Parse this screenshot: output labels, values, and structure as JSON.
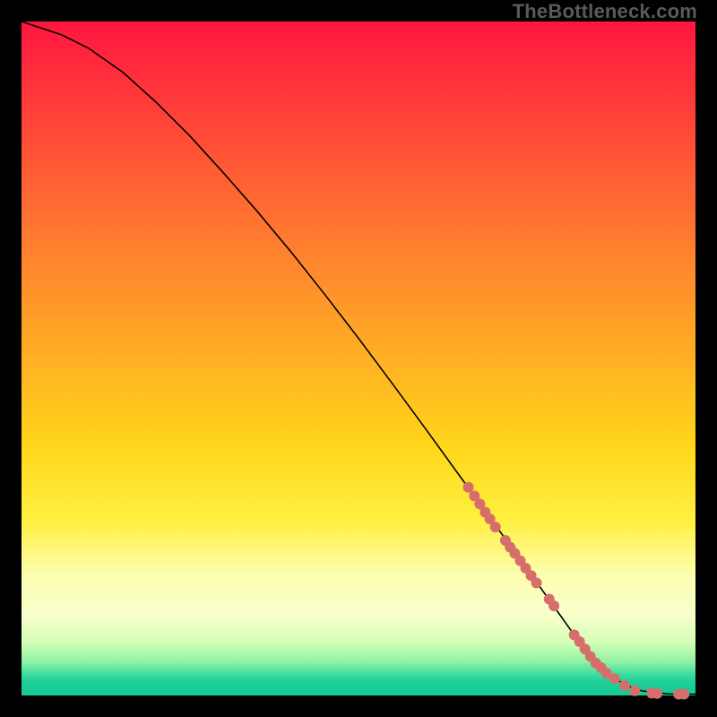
{
  "watermark": "TheBottleneck.com",
  "chart_data": {
    "type": "line",
    "title": "",
    "xlabel": "",
    "ylabel": "",
    "xlim": [
      0,
      100
    ],
    "ylim": [
      0,
      100
    ],
    "grid": false,
    "legend": false,
    "series": [
      {
        "name": "curve",
        "x": [
          0,
          3,
          6,
          10,
          15,
          20,
          25,
          30,
          35,
          40,
          45,
          50,
          55,
          60,
          65,
          70,
          75,
          80,
          82,
          84,
          86,
          88,
          90,
          92,
          94,
          96,
          98,
          100
        ],
        "y": [
          100,
          99,
          98,
          96,
          92.5,
          88,
          83,
          77.5,
          71.8,
          65.8,
          59.5,
          53,
          46.3,
          39.5,
          32.6,
          25.7,
          18.8,
          11.8,
          9,
          6.3,
          4.1,
          2.5,
          1.4,
          0.7,
          0.4,
          0.25,
          0.2,
          0.2
        ]
      }
    ],
    "points": {
      "name": "dots",
      "x": [
        66.3,
        67.2,
        68.0,
        68.8,
        69.5,
        70.3,
        71.8,
        72.5,
        73.2,
        74.0,
        74.8,
        75.6,
        76.4,
        78.3,
        79.0,
        82.0,
        82.8,
        83.6,
        84.4,
        85.2,
        86.0,
        86.8,
        88.0,
        89.5,
        91.0,
        93.5,
        94.3,
        97.5,
        98.3
      ],
      "y": [
        30.9,
        29.6,
        28.4,
        27.2,
        26.2,
        25.0,
        23.0,
        22.0,
        21.1,
        20.0,
        18.9,
        17.8,
        16.7,
        14.3,
        13.3,
        9.0,
        8.0,
        6.9,
        5.8,
        4.8,
        4.1,
        3.3,
        2.5,
        1.5,
        0.7,
        0.35,
        0.3,
        0.2,
        0.2
      ]
    },
    "colors": {
      "curve": "#000000",
      "dots": "#d66e6b",
      "gradient_top": "#ff163f",
      "gradient_mid": "#fff040",
      "gradient_bottom": "#18c896"
    }
  }
}
